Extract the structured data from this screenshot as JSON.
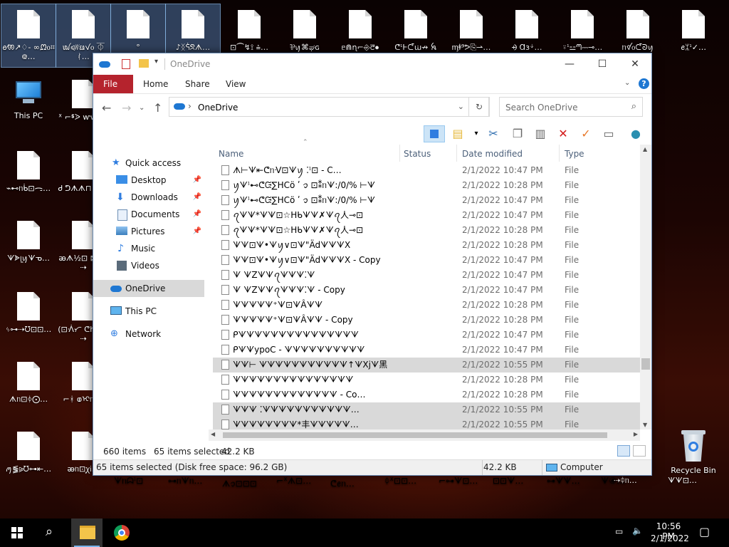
{
  "desktop": {
    "top_icons": [
      {
        "label": "ꫀ⁄ꫦ↗♢- ∞ᘻ᧐⌗᪤…"
      },
      {
        "label": "ꪢ⪨ᜦᨹꪚ᧐ ⏁ᚰ…"
      },
      {
        "label": "°"
      },
      {
        "label": "♪ᛝᣅᘝᗑ…"
      },
      {
        "label": "⊡⏜↯⟟ ⩮…"
      },
      {
        "label": "⅌ꪗ⌘ಘɢ"
      },
      {
        "label": "ᥱ⋒ɳ⌐⎆ꯂ⦁"
      },
      {
        "label": "ᕦᣳⱵᘭꭐ↛ ꫝ"
      },
      {
        "label": "ᶆꬸ⁹ᕗ⎘⇀…"
      },
      {
        "label": "⨮ Ɑɜᛎ…"
      },
      {
        "label": "⍤ᣳ⚍ᘉ⎓⊸…"
      },
      {
        "label": "ᥒꪤ᧐ᘭᘐꪗ"
      },
      {
        "label": "ꫀᛯᣳ✓…"
      }
    ],
    "left_col1": [
      {
        "label": "This PC"
      },
      {
        "label": "ꪑ⪓⪩ᘮ⊶⇤…"
      },
      {
        "label": "⌁⊷ᥒᑳ⊡ᯏ…"
      },
      {
        "label": "ᗐᗎᥧꪗᗐᓀ…"
      },
      {
        "label": "ᛃ⊶⇢ᘮ⊡⊡…"
      },
      {
        "label": "ᗑᥒ⊡ᛄ⨀…"
      }
    ],
    "left_col2": [
      {
        "label": "ᕽ ⌐ᙚᐷ ⱳⱳꪫᘉ"
      },
      {
        "label": "Ꮷ ᕤᗑᗑ⊓ ⌐…"
      },
      {
        "label": "ꭂᗑ½⊡ ⊠▇Ꭰ⇢"
      },
      {
        "label": "(⊡ᐾᜆ ᕦꜧ⊡ᗊ⇢"
      },
      {
        "label": "⌐ᚼ ⱷᢈᥒ(⊡"
      },
      {
        "label": "ꭂᥒ⊡ꭕᎥ…"
      }
    ],
    "bottom_labels": [
      "ᗐᥒᗣᣳ⊡",
      "⊶ᥒᗐᥒ…",
      "ᗑꪫ⊡⊡⊡",
      "⌐ᕽᗑ⊡…",
      "ᕦꫀᥒ…",
      "ᛰᕽ⊡⊡…",
      "⌐⊶ᗐ⊡…",
      "⊡⊡ᗐ…",
      "⊶ᗐᗐ…",
      "ᗐ④…",
      "⇢ᛰᥒ…",
      "ᗐᗐ⊡…"
    ],
    "recycle_bin": "Recycle Bin"
  },
  "window": {
    "title": "OneDrive",
    "controls": [
      "—",
      "☐",
      "✕"
    ],
    "ribbon_tabs": [
      "File",
      "Home",
      "Share",
      "View"
    ],
    "address": {
      "location": "OneDrive"
    },
    "search_placeholder": "Search OneDrive",
    "nav": {
      "quick_access": "Quick access",
      "items": [
        {
          "label": "Desktop",
          "icon": "desktop-icon",
          "pinned": true
        },
        {
          "label": "Downloads",
          "icon": "downloads-icon",
          "pinned": true
        },
        {
          "label": "Documents",
          "icon": "documents-icon",
          "pinned": true
        },
        {
          "label": "Pictures",
          "icon": "pictures-icon",
          "pinned": true
        },
        {
          "label": "Music",
          "icon": "music-icon",
          "pinned": false
        },
        {
          "label": "Videos",
          "icon": "videos-icon",
          "pinned": false
        }
      ],
      "onedrive": "OneDrive",
      "this_pc": "This PC",
      "network": "Network"
    },
    "columns": [
      "Name",
      "Status",
      "Date modified",
      "Type"
    ],
    "files": [
      {
        "name": "ᗑ⊢ᗐ⇤ᕦᥒᐺ⊡ᗐꪗ ⁚ᣳ⊡ - C…",
        "date": "2/1/2022 10:47 PM",
        "type": "File",
        "selected": false
      },
      {
        "name": "ꪗᗐᣳ⊷ᕦᙍ∑ΗCö ʹ ꪫ ⊡⁑ᥒᗐ:/0/% ⊢ᗐ",
        "date": "2/1/2022 10:28 PM",
        "type": "File",
        "selected": false
      },
      {
        "name": "ꪗᗐᣳ⊷ᕦᙍ∑ΗCö ʹ ꪫ ⊡⁑ᥒᗐ:/0/% ⊢ᗐ",
        "date": "2/1/2022 10:47 PM",
        "type": "File",
        "selected": false
      },
      {
        "name": "ꪖᗐᗐ*ᗐᗐ⊡☆Ηᑲᗐᗐ✗ᗐꪖ人⊸⊡",
        "date": "2/1/2022 10:47 PM",
        "type": "File",
        "selected": false
      },
      {
        "name": "ꪖᗐᗐ*ᗐᗐ⊡☆Ηᑲᗐᗐ✗ᗐꪖ人⊸⊡",
        "date": "2/1/2022 10:28 PM",
        "type": "File",
        "selected": false
      },
      {
        "name": "ᗐᗐ⊡ᗐ•ᗐꪗ∨⊡ᗐ\"ÄdᗐᗐᗐX",
        "date": "2/1/2022 10:28 PM",
        "type": "File",
        "selected": false
      },
      {
        "name": "ᗐᗐ⊡ᗐ•ᗐꪗ∨⊡ᗐ\"ÄdᗐᗐᗐX - Copy",
        "date": "2/1/2022 10:47 PM",
        "type": "File",
        "selected": false
      },
      {
        "name": "ᗐ ᗐZᗐᗐꪖᗐᗐᗐ⁚ᗐ",
        "date": "2/1/2022 10:47 PM",
        "type": "File",
        "selected": false
      },
      {
        "name": "ᗐ ᗐZᗐᗐꪖᗐᗐᗐ⁚ᗐ - Copy",
        "date": "2/1/2022 10:47 PM",
        "type": "File",
        "selected": false
      },
      {
        "name": "ᗐᗐᗐᗐᗐ⁺ᗐ⊡ᗐÂᗐᗐ",
        "date": "2/1/2022 10:28 PM",
        "type": "File",
        "selected": false
      },
      {
        "name": "ᗐᗐᗐᗐᗐ⁺ᗐ⊡ᗐÂᗐᗐ - Copy",
        "date": "2/1/2022 10:28 PM",
        "type": "File",
        "selected": false
      },
      {
        "name": "ᑭᗐᗐᗐᗐᗐᗐᗐᗐᗐᗐᗐᗐᗐᗐᗐ",
        "date": "2/1/2022 10:47 PM",
        "type": "File",
        "selected": false
      },
      {
        "name": "ᑭᗐᗐypoC - ᗐᗐᗐᗐᗐᗐᗐᗐᗐᗐ",
        "date": "2/1/2022 10:47 PM",
        "type": "File",
        "selected": false
      },
      {
        "name": "ᗐᗐ⊢ ᗐᗐᗐᗐᗐᗐᗐᗐᗐᗐᗐ↑ᗐXjᗐ黑",
        "date": "2/1/2022 10:55 PM",
        "type": "File",
        "selected": true
      },
      {
        "name": "ᗐᗐᗐᗐᗐᗐᗐᗐᗐᗐᗐᗐᗐᗐᗐ",
        "date": "2/1/2022 10:28 PM",
        "type": "File",
        "selected": false
      },
      {
        "name": "ᗐᗐᗐᗐᗐᗐᗐᗐᗐᗐᗐᗐᗐ - Co…",
        "date": "2/1/2022 10:28 PM",
        "type": "File",
        "selected": false
      },
      {
        "name": "ᗐᗐᗐ ⁚ᗐᗐᗐᗐᗐᗐᗐᗐᗐᗐᗐ…",
        "date": "2/1/2022 10:55 PM",
        "type": "File",
        "selected": true
      },
      {
        "name": "ᗐᗐᗐᗐᗐᗐᗐᗐ*丰ᗐᗐᗐᗐᗐ…",
        "date": "2/1/2022 10:55 PM",
        "type": "File",
        "selected": true
      }
    ],
    "status_items_count": "660 items",
    "status_selected_count": "65 items selected",
    "status_size": "42.2 KB",
    "details_left": "65 items selected (Disk free space: 96.2 GB)",
    "details_size": "42.2 KB",
    "details_location": "Computer"
  },
  "taskbar": {
    "time": "10:56 PM",
    "date": "2/1/2022"
  },
  "colors": {
    "accent": "#1e77d2",
    "file_tab": "#b5232d"
  }
}
